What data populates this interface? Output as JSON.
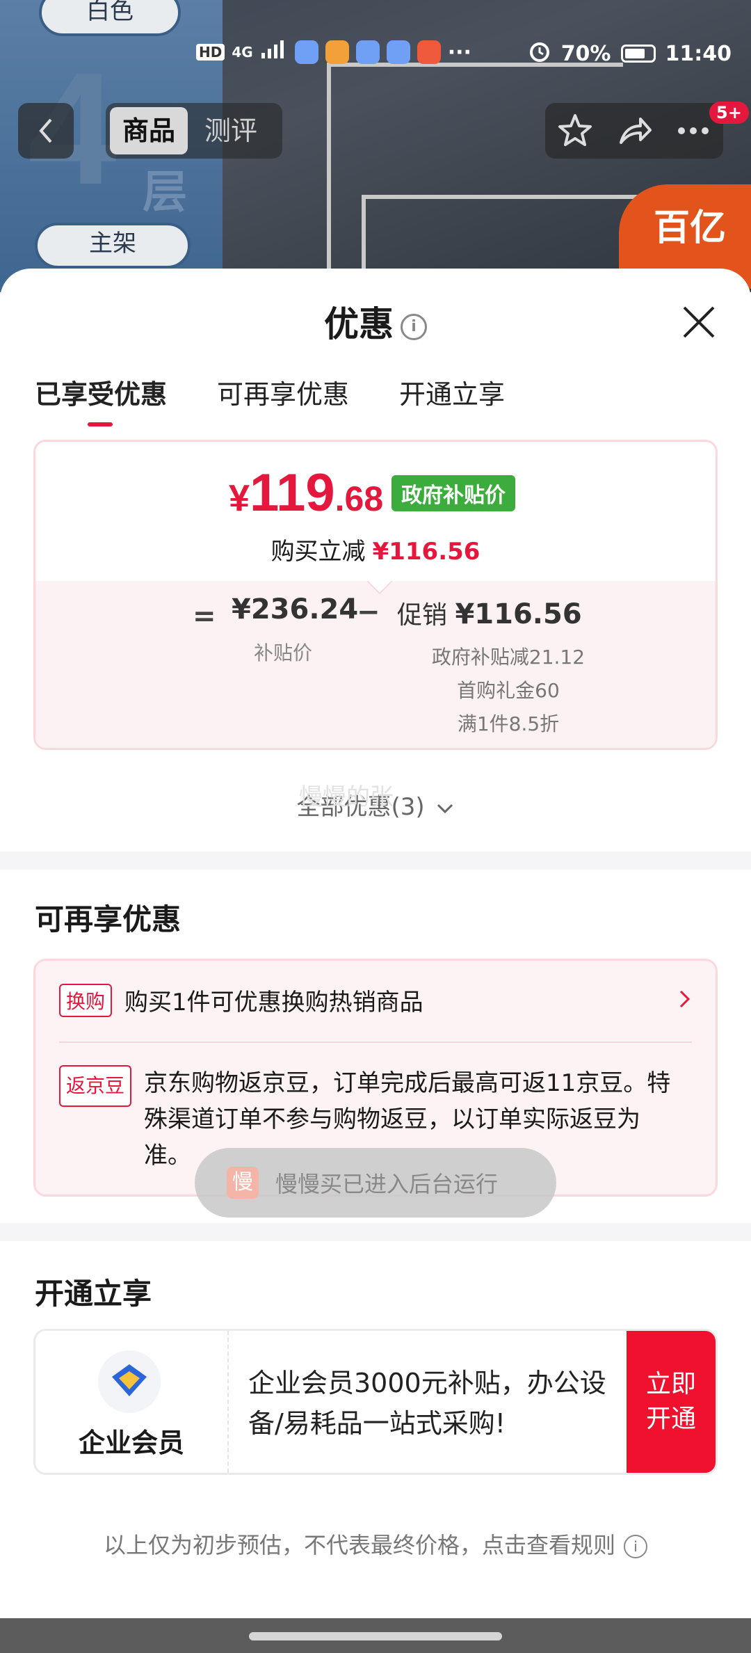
{
  "status_bar": {
    "left_icons": [
      "HD",
      "4G"
    ],
    "battery": "70%",
    "time": "11:40"
  },
  "product_bg": {
    "color_tag": "白色",
    "layers_number": "4",
    "layers_unit": "层",
    "frame_tag": "主架",
    "brand_badge": "百亿"
  },
  "nav": {
    "tabs": [
      {
        "label": "商品"
      },
      {
        "label": "测评"
      }
    ],
    "badge": "5+"
  },
  "sheet": {
    "title": "优惠",
    "tabs": [
      {
        "label": "已享受优惠"
      },
      {
        "label": "可再享优惠"
      },
      {
        "label": "开通立享"
      }
    ]
  },
  "price_card": {
    "currency": "¥",
    "final_int": "119",
    "final_dec": ".68",
    "gov_tag": "政府补贴价",
    "buy_reduce_label": "购买立减",
    "buy_reduce_amount": "¥116.56",
    "eq": "=",
    "subsidy_price": "¥236.24",
    "subsidy_label": "补贴价",
    "minus": "−",
    "promo_label": "促销",
    "promo_amount": "¥116.56",
    "promo_items": [
      "政府补贴减21.12",
      "首购礼金60",
      "满1件8.5折"
    ]
  },
  "all_promo": "全部优惠(3)",
  "more_section": {
    "title": "可再享优惠",
    "items": [
      {
        "tag": "换购",
        "text": "购买1件可优惠换购热销商品"
      },
      {
        "tag": "返京豆",
        "text": "京东购物返京豆，订单完成后最高可返11京豆。特殊渠道订单不参与购物返豆，以订单实际返豆为准。"
      }
    ]
  },
  "vip_section": {
    "title": "开通立享",
    "name": "企业会员",
    "desc": "企业会员3000元补贴，办公设备/易耗品一站式采购!",
    "button": "立即开通"
  },
  "toast": {
    "icon_text": "慢",
    "text": "慢慢买已进入后台运行"
  },
  "footer_note": "以上仅为初步预估，不代表最终价格，点击查看规则",
  "watermark": "慢慢的张",
  "colors": {
    "accent": "#e4183c",
    "gov_green": "#3cad3c",
    "vip_button": "#f0112e"
  }
}
